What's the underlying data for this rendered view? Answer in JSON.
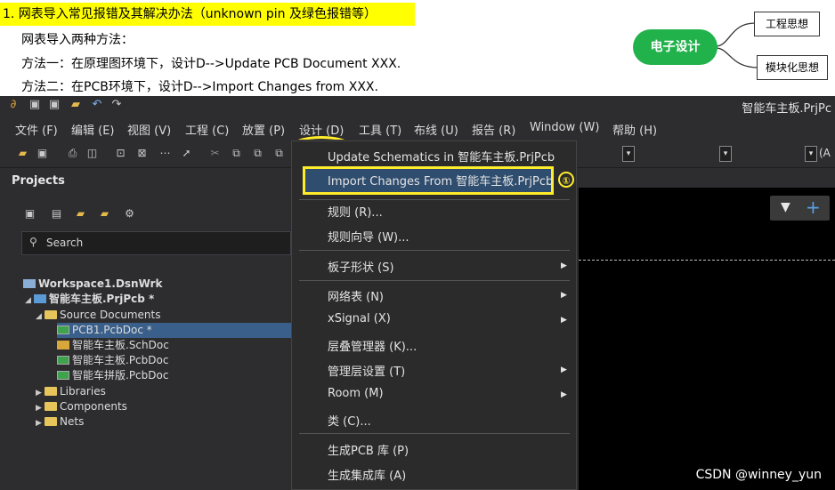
{
  "header": {
    "highlight_title": "1. 网表导入常见报错及其解决办法（unknown pin 及绿色报错等）",
    "intro": "网表导入两种方法：",
    "method1": "方法一：在原理图环境下，设计D-->Update PCB Document XXX.",
    "method2": "方法二：在PCB环境下，设计D-->Import Changes from XXX."
  },
  "mindmap": {
    "center": "电子设计",
    "top": "工程思想",
    "bottom": "模块化思想",
    "center_color": "#22b24c"
  },
  "app": {
    "title": "智能车主板.PrjPc",
    "menus": [
      "文件 (F)",
      "编辑 (E)",
      "视图 (V)",
      "工程 (C)",
      "放置 (P)",
      "设计 (D)",
      "工具 (T)",
      "布线 (U)",
      "报告 (R)",
      "Window (W)",
      "帮助 (H)"
    ],
    "toolbar_right_label": "(A"
  },
  "projects": {
    "title": "Projects",
    "search_placeholder": "Search",
    "tree": [
      {
        "label": "Workspace1.DsnWrk",
        "bold": true
      },
      {
        "label": "智能车主板.PrjPcb *",
        "bold": true
      },
      {
        "label": "Source Documents"
      },
      {
        "label": "PCB1.PcbDoc *"
      },
      {
        "label": "智能车主板.SchDoc"
      },
      {
        "label": "智能车主板.PcbDoc"
      },
      {
        "label": "智能车拼版.PcbDoc"
      },
      {
        "label": "Libraries"
      },
      {
        "label": "Components"
      },
      {
        "label": "Nets"
      }
    ]
  },
  "dropdown": {
    "items": [
      "Update Schematics in 智能车主板.PrjPcb",
      "Import Changes From 智能车主板.PrjPcb",
      "规则 (R)...",
      "规则向导 (W)...",
      "板子形状 (S)",
      "网络表 (N)",
      "xSignal (X)",
      "层叠管理器 (K)...",
      "管理层设置 (T)",
      "Room (M)",
      "类 (C)...",
      "生成PCB 库 (P)",
      "生成集成库 (A)"
    ],
    "step_marker": "①"
  },
  "watermark": "CSDN @winney_yun",
  "colors": {
    "highlight": "#ffff00",
    "ring": "#ffec2b",
    "selection": "#3a5f8a"
  }
}
